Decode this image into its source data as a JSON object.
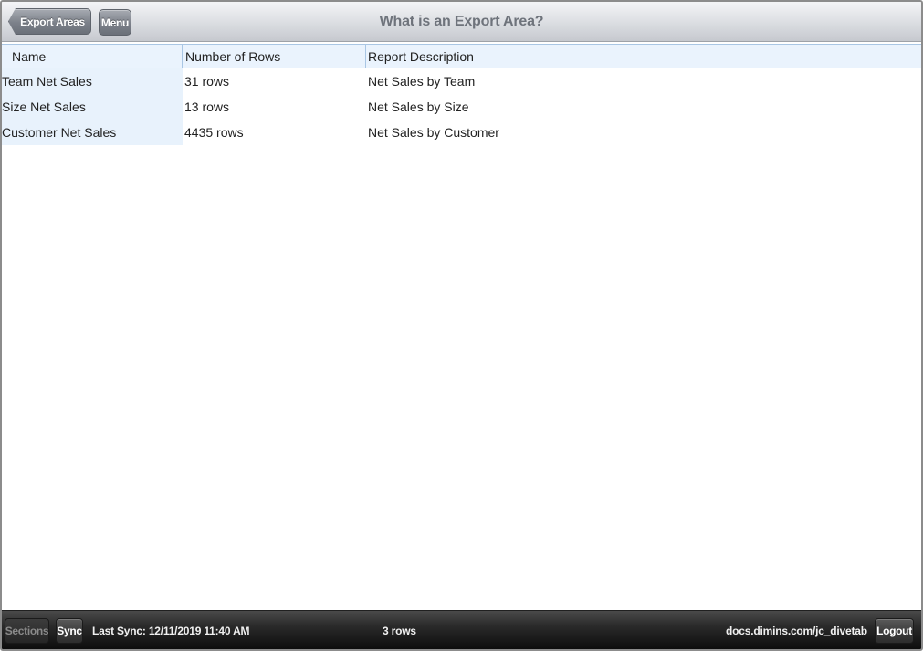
{
  "toolbar": {
    "back_label": "Export Areas",
    "menu_label": "Menu",
    "title": "What is an Export Area?"
  },
  "table": {
    "columns": [
      "Name",
      "Number of Rows",
      "Report Description"
    ],
    "rows": [
      [
        "Team Net Sales",
        "31 rows",
        "Net Sales by Team"
      ],
      [
        "Size Net Sales",
        "13 rows",
        "Net Sales by Size"
      ],
      [
        "Customer Net Sales",
        "4435 rows",
        "Net Sales by Customer"
      ]
    ]
  },
  "footer": {
    "sections_label": "Sections",
    "sync_label": "Sync",
    "last_sync": "Last Sync: 12/11/2019 11:40 AM",
    "row_count": "3 rows",
    "site": "docs.dimins.com/jc_divetab",
    "logout_label": "Logout"
  },
  "colors": {
    "header_bg": "#eaf3fd",
    "name_column_bg": "#e8f2fc",
    "footer_bg": "#1a1a1a",
    "title_text": "#6e737b"
  }
}
